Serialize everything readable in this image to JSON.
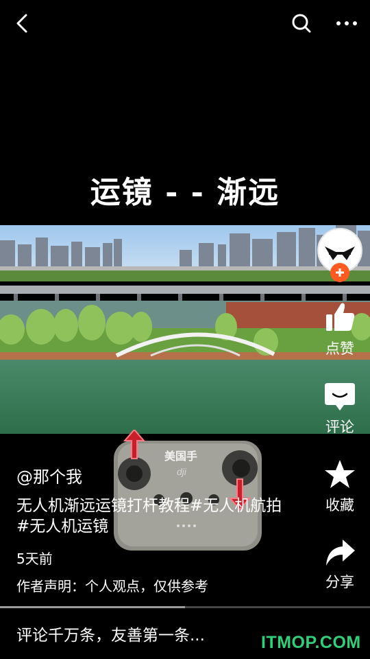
{
  "topbar": {
    "back_icon": "back-arrow-icon",
    "search_icon": "search-icon",
    "more_icon": "more-icon"
  },
  "video": {
    "title": "运镜 - - 渐远",
    "remote_brand": "美国手",
    "remote_logo": "dji"
  },
  "sidebar": {
    "follow_icon": "plus-icon",
    "like_label": "点赞",
    "comment_label": "评论",
    "collect_label": "收藏",
    "share_label": "分享"
  },
  "post": {
    "author": "@那个我",
    "description": "无人机渐远运镜打杆教程#无人机航拍#无人机运镜",
    "time_ago": "5天前",
    "declaration": "作者声明：个人观点，仅供参考"
  },
  "progress": {
    "fraction": 0.5
  },
  "comment_input": {
    "placeholder": "评论千万条，友善第一条..."
  },
  "watermark": "ITMOP.COM",
  "colors": {
    "accent": "#ff5a1f",
    "watermark": "#2fd07a",
    "background": "#000000"
  }
}
